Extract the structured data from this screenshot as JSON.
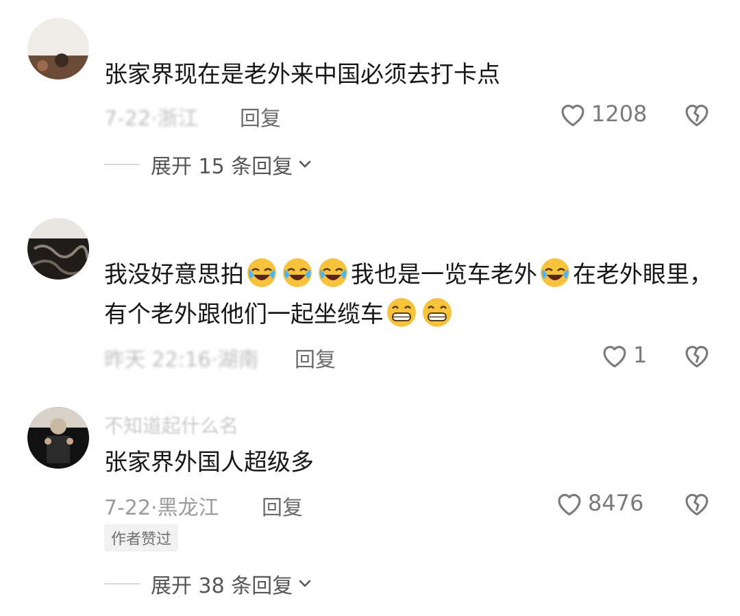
{
  "comments": [
    {
      "text": "张家界现在是老外来中国必须去打卡点",
      "meta": "7-22·浙江",
      "reply_label": "回复",
      "likes": "1208",
      "expand_label": "展开 15 条回复"
    },
    {
      "text_parts": [
        "我没好意思拍",
        "我也是一览车老外",
        "在老外眼里，有个老外跟他们一起坐缆车"
      ],
      "meta": "昨天 22:16·湖南",
      "reply_label": "回复",
      "likes": "1"
    },
    {
      "username": "不知道起什么名",
      "text": "张家界外国人超级多",
      "meta": "7-22·黑龙江",
      "reply_label": "回复",
      "likes": "8476",
      "badge": "作者赞过",
      "expand_label": "展开 38 条回复"
    }
  ],
  "icons": {
    "like": "heart-outline-icon",
    "dislike": "broken-heart-icon",
    "expand": "chevron-down-icon",
    "emoji_cry_laugh": "rolling-laughing-emoji",
    "emoji_grin": "grinning-emoji"
  },
  "colors": {
    "text": "#161616",
    "meta": "#9a9a9a",
    "icon": "#7a7a7a",
    "emoji": "#f7c23c"
  }
}
